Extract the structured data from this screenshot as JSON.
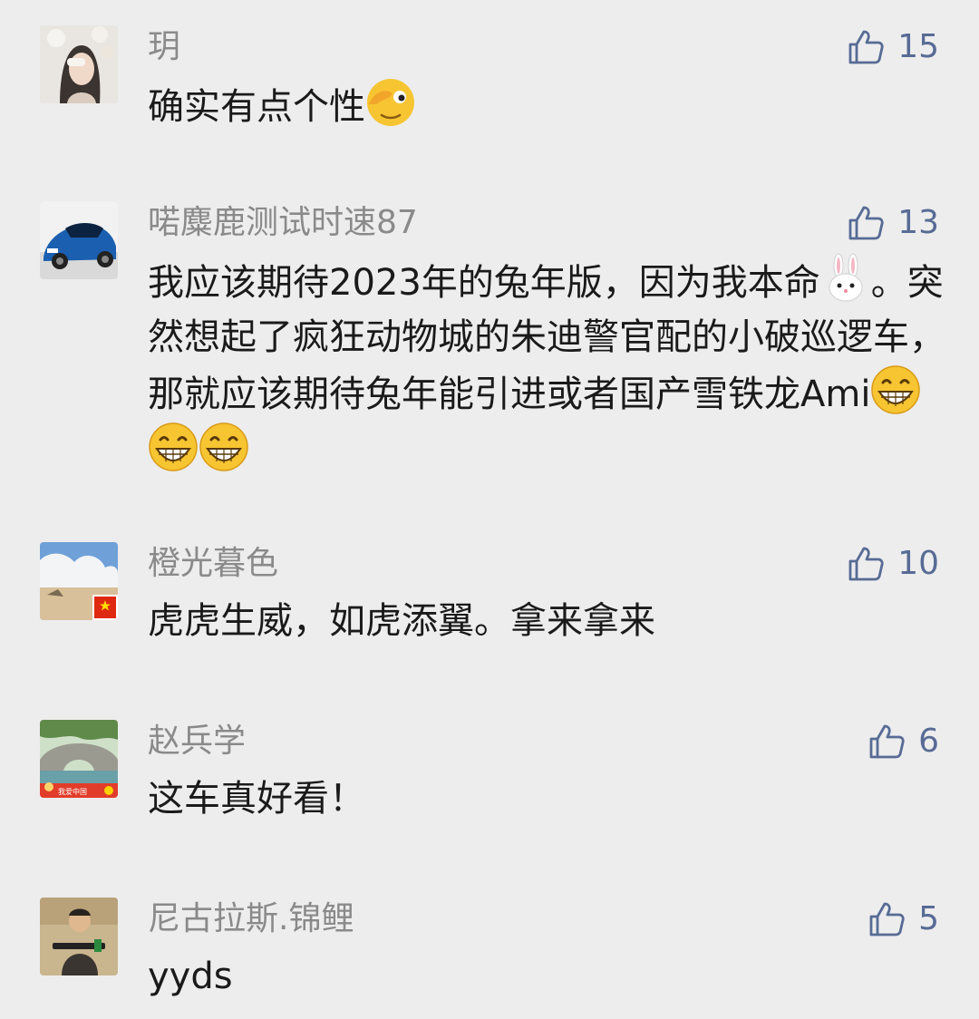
{
  "comments": [
    {
      "username": "玥",
      "text": "确实有点个性",
      "likes": "15",
      "emoji_after": "face-covering-eye-emoji"
    },
    {
      "username": "喏麋鹿测试时速87",
      "text_part1": "我应该期待2023年的兔年版，因为我本命",
      "text_part2": "。突然想起了疯狂动物城的朱迪警官配的小破巡逻车，那就应该期待兔年能引进或者国产雪铁龙Ami",
      "likes": "13",
      "emojis": [
        "rabbit-emoji",
        "grin-emoji",
        "grin-emoji",
        "grin-emoji"
      ]
    },
    {
      "username": "橙光暮色",
      "text": "虎虎生威，如虎添翼。拿来拿来",
      "likes": "10"
    },
    {
      "username": "赵兵学",
      "text": "这车真好看！",
      "likes": "6",
      "avatar_badge": "我爱中国"
    },
    {
      "username": "尼古拉斯.锦鲤",
      "text": "yyds",
      "likes": "5"
    }
  ],
  "colors": {
    "background": "#ededed",
    "username": "#8a8a8a",
    "text": "#1a1a1a",
    "like": "#576b95"
  }
}
